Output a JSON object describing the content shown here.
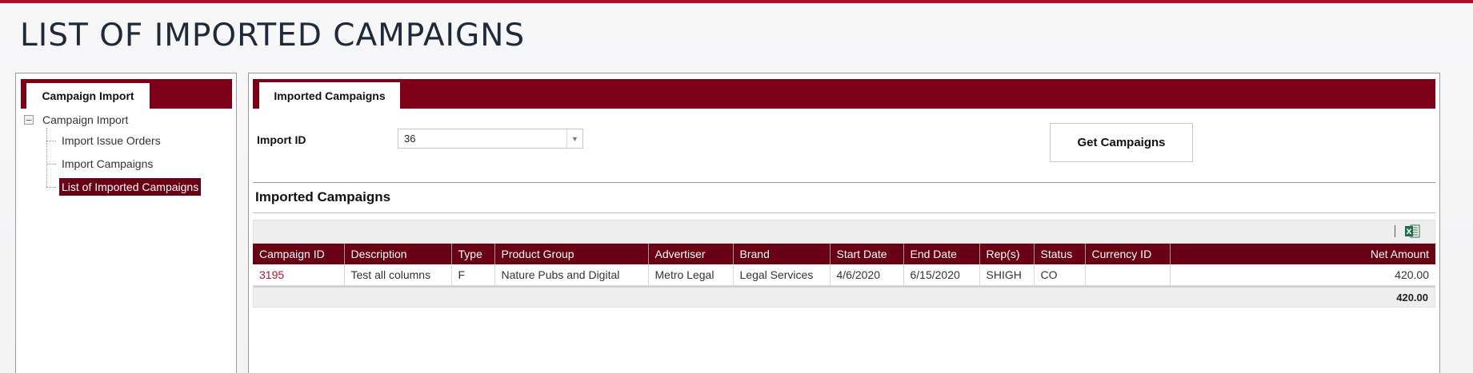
{
  "page": {
    "title": "LIST OF IMPORTED CAMPAIGNS"
  },
  "colors": {
    "accent": "#7d0019",
    "selected": "#6a0014",
    "link": "#b01530",
    "top_stripe": "#a8102b"
  },
  "left_panel": {
    "tab_label": "Campaign Import",
    "tree": {
      "root_label": "Campaign Import",
      "toggle_symbol": "−",
      "items": [
        {
          "label": "Import Issue Orders"
        },
        {
          "label": "Import Campaigns"
        },
        {
          "label": "List of Imported Campaigns",
          "selected": true
        }
      ]
    }
  },
  "right_panel": {
    "tab_label": "Imported Campaigns",
    "import_id": {
      "label": "Import ID",
      "value": "36"
    },
    "get_button_label": "Get Campaigns",
    "section_title": "Imported Campaigns",
    "toolbar": {
      "export_icon": "excel-export-icon"
    },
    "grid": {
      "columns": [
        "Campaign ID",
        "Description",
        "Type",
        "Product Group",
        "Advertiser",
        "Brand",
        "Start Date",
        "End Date",
        "Rep(s)",
        "Status",
        "Currency ID",
        "Net Amount"
      ],
      "rows": [
        {
          "campaign_id": "3195",
          "description": "Test all columns",
          "type": "F",
          "product_group": "Nature Pubs and Digital",
          "advertiser": "Metro Legal",
          "brand": "Legal Services",
          "start_date": "4/6/2020",
          "end_date": "6/15/2020",
          "reps": "SHIGH",
          "status": "CO",
          "currency_id": "",
          "net_amount": "420.00"
        }
      ],
      "footer_total": "420.00"
    }
  }
}
